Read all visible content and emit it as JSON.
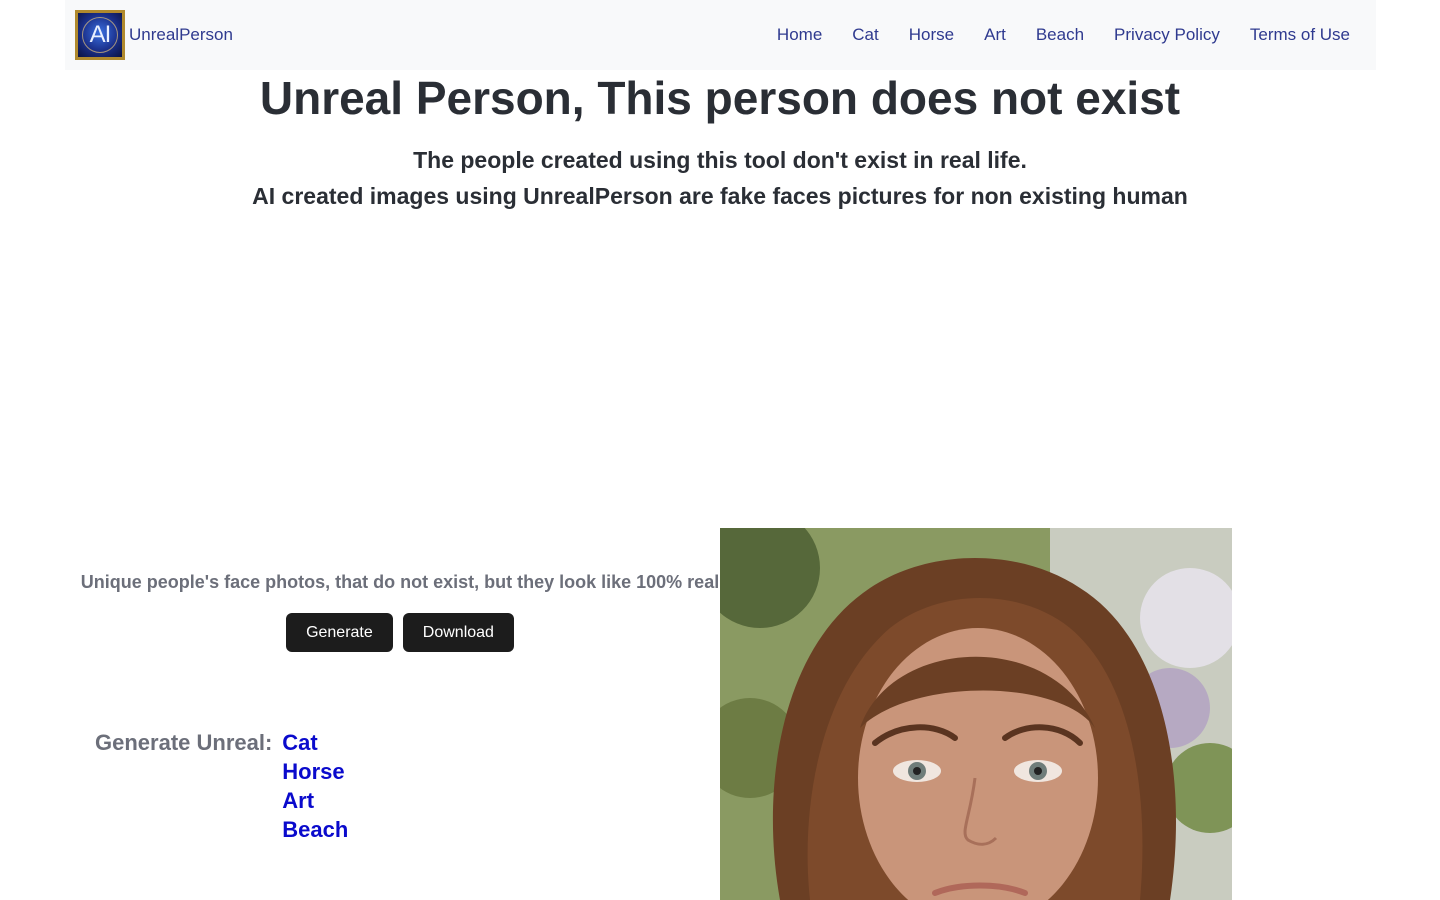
{
  "nav": {
    "logo_text": "AI",
    "brand": "UnrealPerson",
    "links": [
      {
        "label": "Home"
      },
      {
        "label": "Cat"
      },
      {
        "label": "Horse"
      },
      {
        "label": "Art"
      },
      {
        "label": "Beach"
      },
      {
        "label": "Privacy Policy"
      },
      {
        "label": "Terms of Use"
      }
    ]
  },
  "hero": {
    "title": "Unreal Person, This person does not exist",
    "subtitle_1": "The people created using this tool don't exist in real life.",
    "subtitle_2": "AI created images using UnrealPerson are fake faces pictures for non existing human"
  },
  "tool": {
    "tagline": "Unique people's face photos, that do not exist, but they look like 100% real",
    "generate_label": "Generate",
    "download_label": "Download"
  },
  "generate_unreal": {
    "label": "Generate Unreal:",
    "links": [
      "Cat",
      "Horse",
      "Art",
      "Beach"
    ]
  },
  "colors": {
    "nav_bg": "#f8f9fa",
    "link": "#2f3a8f",
    "button_bg": "#1c1c1c",
    "category_link": "#0a0acc"
  }
}
